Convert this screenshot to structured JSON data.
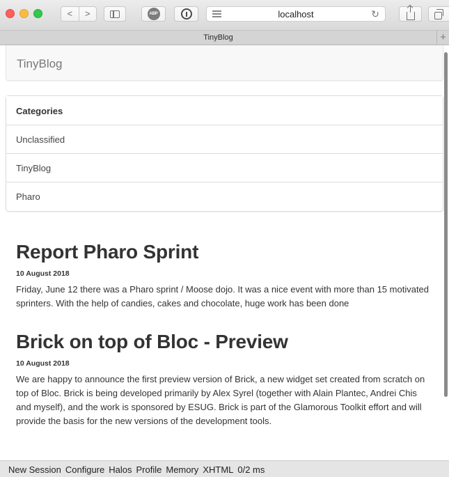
{
  "browser": {
    "address": "localhost",
    "tab_title": "TinyBlog",
    "nav_back": "<",
    "nav_forward": ">",
    "adblock_label": "ABP",
    "reload_glyph": "↻",
    "new_tab_glyph": "+"
  },
  "header": {
    "brand": "TinyBlog"
  },
  "categories": {
    "heading": "Categories",
    "items": [
      "Unclassified",
      "TinyBlog",
      "Pharo"
    ]
  },
  "posts": [
    {
      "title": "Report Pharo Sprint",
      "date": "10 August 2018",
      "body": "Friday, June 12 there was a Pharo sprint / Moose dojo. It was a nice event with more than 15 motivated sprinters. With the help of candies, cakes and chocolate, huge work has been done"
    },
    {
      "title": "Brick on top of Bloc - Preview",
      "date": "10 August 2018",
      "body": "We are happy to announce the first preview version of Brick, a new widget set created from scratch on top of Bloc. Brick is being developed primarily by Alex Syrel (together with Alain Plantec, Andrei Chis and myself), and the work is sponsored by ESUG. Brick is part of the Glamorous Toolkit effort and will provide the basis for the new versions of the development tools."
    }
  ],
  "statusbar": {
    "items": [
      "New Session",
      "Configure",
      "Halos",
      "Profile",
      "Memory",
      "XHTML",
      "0/2 ms"
    ]
  }
}
